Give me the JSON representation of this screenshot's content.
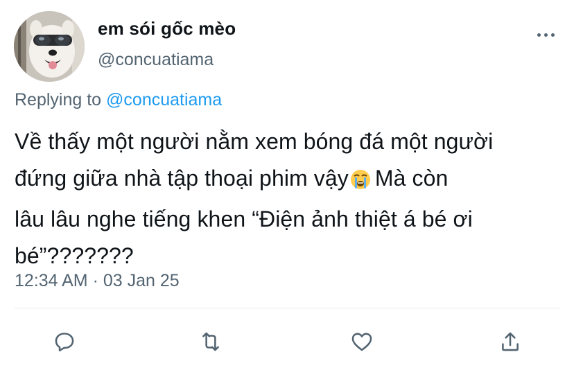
{
  "author": {
    "display_name": "em sói gốc mèo",
    "handle": "@concuatiama"
  },
  "reply": {
    "prefix": "Replying to",
    "to_handle": "@concuatiama"
  },
  "tweet": {
    "line1": "Về thấy một người nằm xem bóng đá một người",
    "line2_before_emoji": "đứng giữa nhà tập thoại phim vậy",
    "emoji": "loudly-crying-face",
    "line2_after_emoji": "Mà còn",
    "line3": "lâu lâu nghe tiếng khen “Điện ảnh thiệt á bé ơi",
    "line4": "bé”???????"
  },
  "meta": {
    "time": "12:34 AM",
    "separator": "·",
    "date": "03 Jan 25"
  },
  "actions": [
    "reply-icon",
    "retweet-icon",
    "like-icon",
    "share-icon"
  ],
  "colors": {
    "text": "#0f1419",
    "secondary": "#536471",
    "link": "#1d9bf0",
    "divider": "#e5e8eb"
  }
}
